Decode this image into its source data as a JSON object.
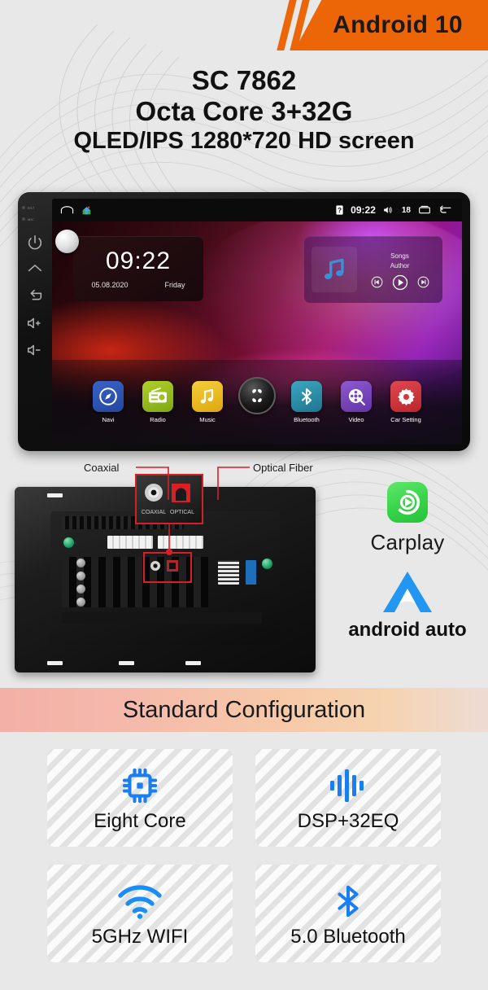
{
  "banner": {
    "label": "Android 10",
    "color": "#ec6608"
  },
  "headline": {
    "line1": "SC 7862",
    "line2": "Octa Core 3+32G",
    "line3": "QLED/IPS 1280*720 HD screen"
  },
  "head_unit": {
    "bezel": {
      "led_reset": "RST",
      "led_mic": "MIC",
      "keys": [
        "power-icon",
        "home-icon",
        "back-icon",
        "volume-up-icon",
        "volume-down-icon"
      ],
      "knob": "volume-knob"
    },
    "status_bar": {
      "left_icons": [
        "dock-icon",
        "home-house-icon"
      ],
      "sim_icon": "sim-card-icon",
      "time": "09:22",
      "volume_icon": "volume-icon",
      "volume_level": "18",
      "recents_icon": "recents-icon",
      "back_icon": "back-arrow-icon"
    },
    "clock_widget": {
      "time": "09:22",
      "date": "05.08.2020",
      "weekday": "Friday"
    },
    "music_widget": {
      "album_icon": "music-note-icon",
      "title": "Songs",
      "artist": "Author",
      "prev": "previous-track-icon",
      "play": "play-icon",
      "next": "next-track-icon"
    },
    "dock": [
      {
        "label": "Navi",
        "icon": "compass-icon",
        "color": "#2a53b8"
      },
      {
        "label": "Radio",
        "icon": "radio-icon",
        "color": "#9ec11f"
      },
      {
        "label": "Music",
        "icon": "music-icon",
        "color": "#f0c419"
      },
      {
        "label": "",
        "icon": "apps-grid-icon",
        "color": "#111111"
      },
      {
        "label": "Bluetooth",
        "icon": "bluetooth-icon",
        "color": "#2c8fa8"
      },
      {
        "label": "Video",
        "icon": "film-reel-icon",
        "color": "#7a4bbd"
      },
      {
        "label": "Car Setting",
        "icon": "gear-icon",
        "color": "#d8343c"
      }
    ]
  },
  "callouts": {
    "coaxial": "Coaxial",
    "optical": "Optical Fiber",
    "port_labels": {
      "coaxial": "COAXIAL",
      "optical": "OPTICAL"
    },
    "line_color": "#d81f26"
  },
  "brands": {
    "carplay": {
      "label": "Carplay",
      "icon": "carplay-icon",
      "color": "#37d34a"
    },
    "android_auto": {
      "label": "android auto",
      "icon": "android-auto-icon",
      "color": "#2196f3"
    }
  },
  "config_section": {
    "title": "Standard Configuration",
    "features": [
      {
        "label": "Eight Core",
        "icon": "cpu-chip-icon",
        "color": "#1a7ef0"
      },
      {
        "label": "DSP+32EQ",
        "icon": "equalizer-icon",
        "color": "#1a7ef0"
      },
      {
        "label": "5GHz WIFI",
        "icon": "wifi-icon",
        "color": "#1a8ef5"
      },
      {
        "label": "5.0 Bluetooth",
        "icon": "bluetooth-icon",
        "color": "#1a7ef0"
      }
    ]
  }
}
